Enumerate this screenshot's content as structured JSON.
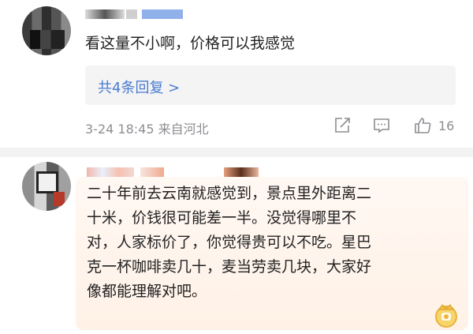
{
  "comments": [
    {
      "text": "看这量不小啊，价格可以我感觉",
      "replies_label": "共4条回复 >",
      "meta": "3-24 18:45 来自河北",
      "like_count": "16",
      "icons": [
        "share-icon",
        "comment-icon",
        "like-icon"
      ]
    },
    {
      "lines": [
        "二十年前去云南就感觉到，景点里外距离二",
        "十米，价钱很可能差一半。没觉得哪里不",
        "对，人家标价了，你觉得贵可以不吃。星巴",
        "克一杯咖啡卖几十，麦当劳卖几块，大家好",
        "像都能理解对吧。"
      ],
      "badge_icon": "crown-badge-icon"
    }
  ],
  "colors": {
    "link": "#4a7bd0",
    "meta": "#8e8e93",
    "reply_bg": "#f4f4f5",
    "bubble_bg": "#fff4ec",
    "divider": "#f2f2f2"
  }
}
